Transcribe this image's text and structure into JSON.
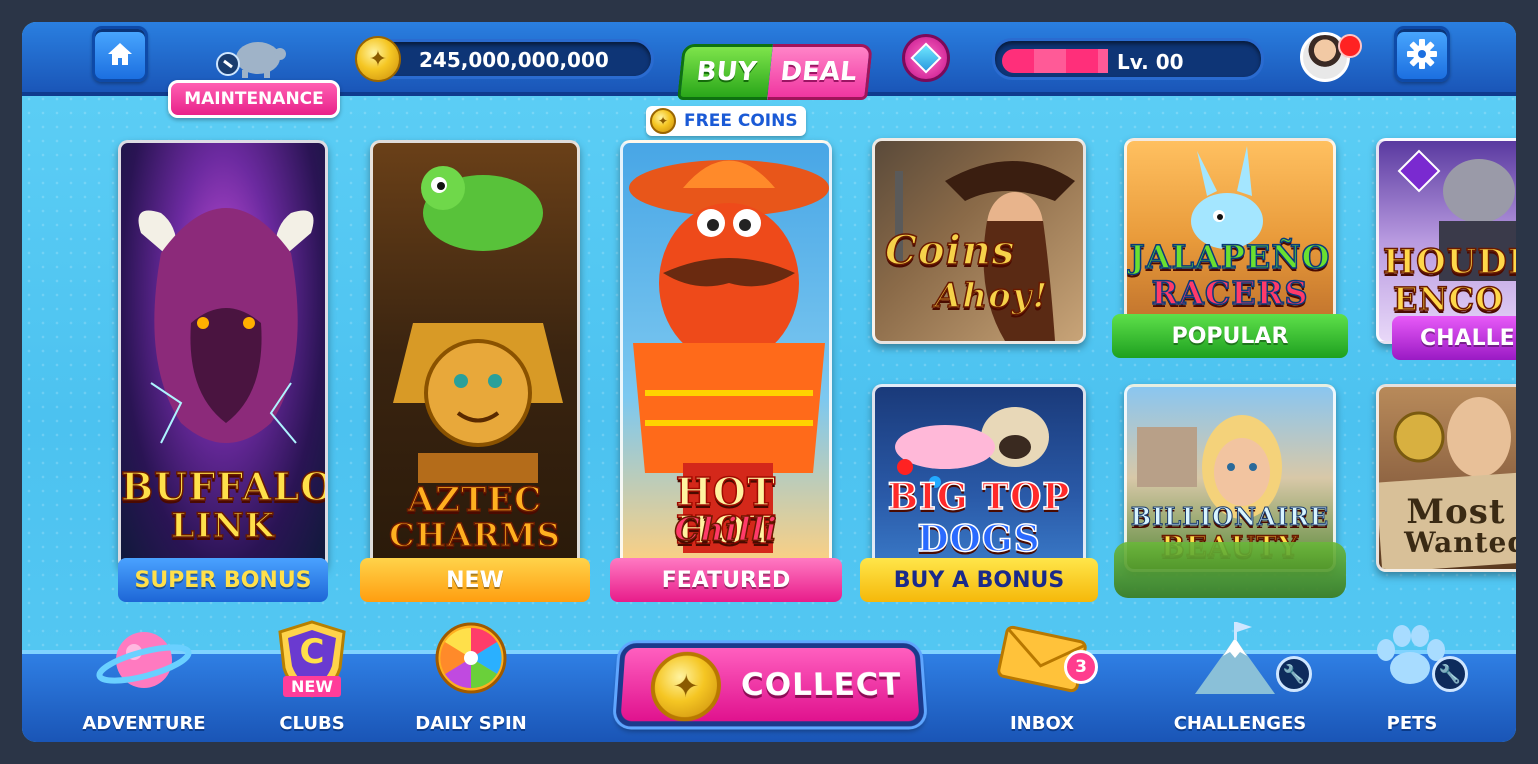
{
  "header": {
    "home_icon": "home-icon",
    "maintenance_label": "MAINTENANCE",
    "balance": "245,000,000,000",
    "buy_label": "BUY",
    "deal_label": "DEAL",
    "free_coins_label": "FREE COINS",
    "level_label": "Lv. 00",
    "level_progress": 0.41,
    "settings_icon": "gear-icon"
  },
  "games": [
    {
      "title_line1": "BUFFALO",
      "title_line2": "LINK",
      "ribbon": "SUPER BONUS",
      "ribbon_color": "#1e78e6"
    },
    {
      "title_line1": "AZTEC",
      "title_line2": "CHARMS",
      "ribbon": "NEW",
      "ribbon_color": "#ffb11a"
    },
    {
      "title_line1": "HOT HOT",
      "title_line2": "Chilli",
      "ribbon": "FEATURED",
      "ribbon_color": "#ff3d9a"
    },
    {
      "title_line1": "Coins",
      "title_line2": "Ahoy!",
      "ribbon": "",
      "ribbon_color": ""
    },
    {
      "title_line1": "JALAPEÑO",
      "title_line2": "RACERS",
      "ribbon": "POPULAR",
      "ribbon_color": "#2fb52a"
    },
    {
      "title_line1": "HOUDI",
      "title_line2": "ENCO",
      "ribbon": "CHALLEN",
      "ribbon_color": "#c02fd8"
    },
    {
      "title_line1": "BIG TOP",
      "title_line2": "DOGS",
      "ribbon": "BUY A BONUS",
      "ribbon_color": "#ffd21a"
    },
    {
      "title_line1": "BILLIONAIRE",
      "title_line2": "BEAUTY",
      "ribbon": "",
      "ribbon_color": ""
    },
    {
      "title_line1": "Most",
      "title_line2": "Wanted",
      "ribbon": "",
      "ribbon_color": ""
    }
  ],
  "bottom_nav": {
    "adventure": "ADVENTURE",
    "clubs": "CLUBS",
    "clubs_badge": "NEW",
    "clubs_letter": "C",
    "daily_spin": "DAILY SPIN",
    "collect": "COLLECT",
    "inbox": "INBOX",
    "inbox_count": "3",
    "challenges": "CHALLENGES",
    "pets": "PETS"
  },
  "colors": {
    "topbar": "#1a56b8",
    "background": "#4cc2f0",
    "accent_pink": "#ff3d9a",
    "accent_green": "#2fb52a"
  }
}
